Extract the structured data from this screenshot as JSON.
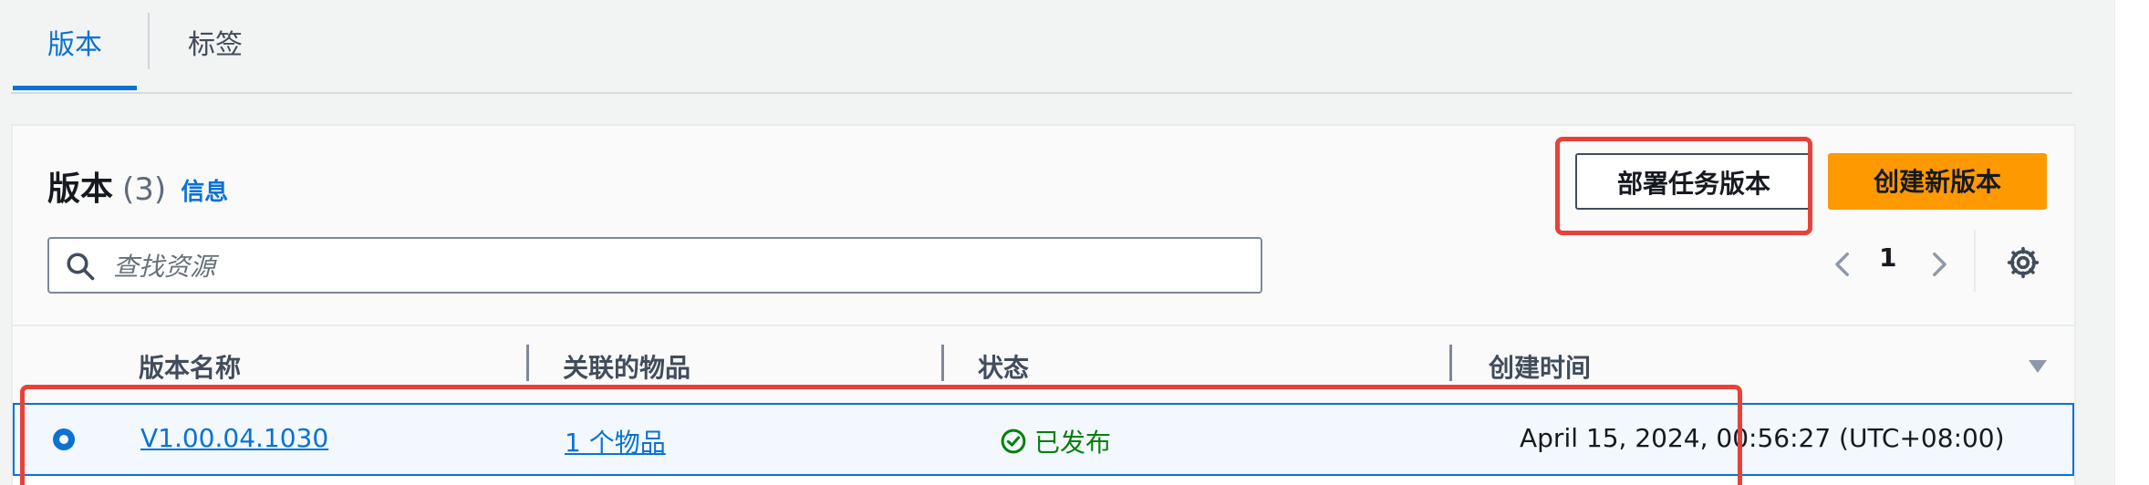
{
  "tabs": [
    {
      "label": "版本",
      "active": true
    },
    {
      "label": "标签",
      "active": false
    }
  ],
  "panel": {
    "title": "版本",
    "count": "(3)",
    "info_link": "信息",
    "deploy_button": "部署任务版本",
    "create_button": "创建新版本",
    "search_placeholder": "查找资源",
    "pagination_page": "1"
  },
  "table": {
    "columns": [
      "版本名称",
      "关联的物品",
      "状态",
      "创建时间"
    ],
    "rows": [
      {
        "selected": true,
        "name": "V1.00.04.1030",
        "associated_items": "1 个物品",
        "status": "已发布",
        "created": "April 15, 2024, 00:56:27 (UTC+08:00)"
      }
    ]
  },
  "colors": {
    "accent_blue": "#0972d3",
    "primary_orange": "#ff9900",
    "status_green": "#037f0c",
    "highlight_red": "#e8413a"
  },
  "icons": [
    "search-icon",
    "chevron-left-icon",
    "chevron-right-icon",
    "gear-icon",
    "sort-down-icon",
    "check-circle-icon",
    "radio-selected-icon"
  ]
}
